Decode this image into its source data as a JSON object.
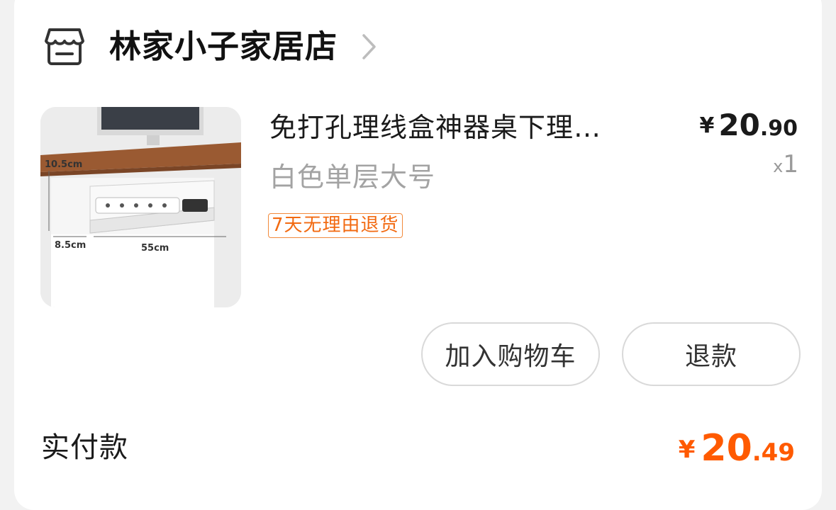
{
  "shop": {
    "name": "林家小子家居店",
    "icon": "store-icon",
    "chevron": "chevron-right-icon"
  },
  "product": {
    "title": "免打孔理线盒神器桌下理…",
    "spec": "白色单层大号",
    "tag": "7天无理由退货",
    "price": {
      "currency": "¥",
      "integer": "20",
      "decimal": ".90"
    },
    "quantity": {
      "prefix": "x",
      "value": "1"
    },
    "image_labels": {
      "height": "10.5cm",
      "depth": "8.5cm",
      "width": "55cm"
    }
  },
  "actions": {
    "add_to_cart": "加入购物车",
    "refund": "退款"
  },
  "payment": {
    "label": "实付款",
    "currency": "¥",
    "integer": "20",
    "decimal": ".49"
  },
  "colors": {
    "accent": "#ff5a00",
    "tag_border": "#f28a3c",
    "muted": "#a3a3a3"
  }
}
